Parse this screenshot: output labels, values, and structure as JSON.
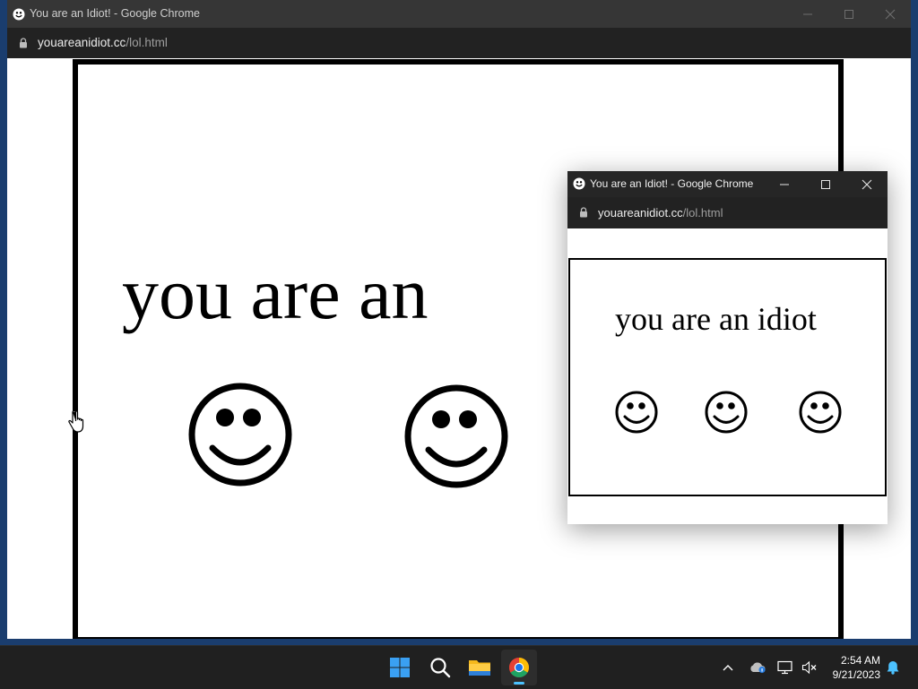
{
  "main_window": {
    "title": "You are an Idiot! - Google Chrome",
    "url_host": "youareanidiot.cc",
    "url_path": "/lol.html",
    "page_text": "you are an",
    "smileys": [
      "smiley-face",
      "smiley-face"
    ]
  },
  "popup_window": {
    "title": "You are an Idiot! - Google Chrome",
    "url_host": "youareanidiot.cc",
    "url_path": "/lol.html",
    "page_text": "you are an idiot",
    "smileys": [
      "smiley-face",
      "smiley-face",
      "smiley-face"
    ]
  },
  "taskbar": {
    "pinned": [
      "start-icon",
      "search-icon",
      "file-explorer-icon",
      "chrome-icon"
    ],
    "active_app": "chrome-icon",
    "tray_icons": [
      "chevron-up-icon",
      "onedrive-icon",
      "network-icon",
      "volume-muted-icon",
      "notification-bell-icon"
    ],
    "clock_time": "2:54 AM",
    "clock_date": "9/21/2023"
  },
  "colors": {
    "titlebar_main": "#363636",
    "titlebar_popup": "#262626",
    "addressbar": "#222222",
    "taskbar": "#202020",
    "accent": "#4cc2ff",
    "desktop": "#1a3d6e"
  }
}
